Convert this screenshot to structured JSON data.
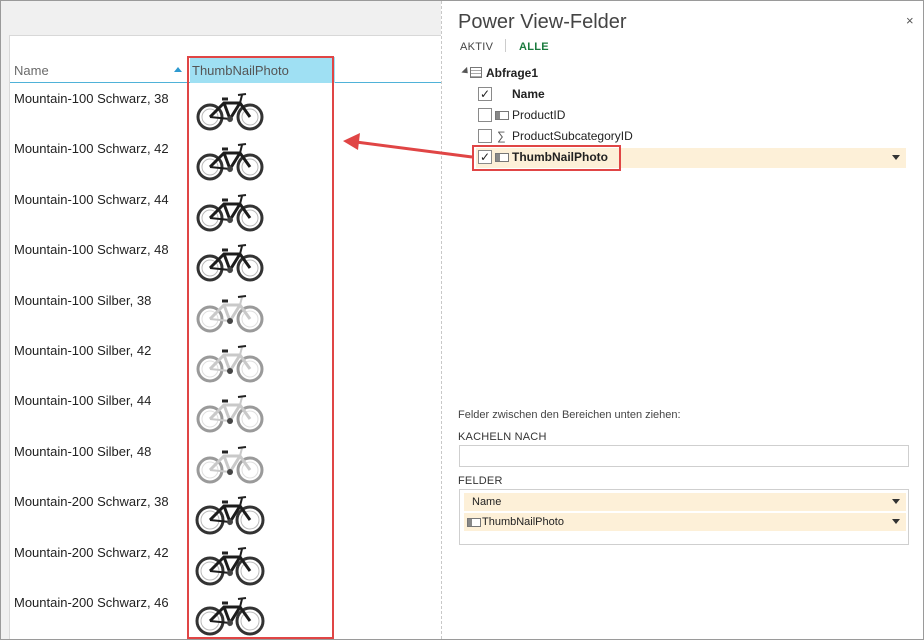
{
  "table": {
    "col_name": "Name",
    "col_thumb": "ThumbNailPhoto",
    "rows": [
      {
        "name": "Mountain-100 Schwarz, 38",
        "bike": "black"
      },
      {
        "name": "Mountain-100 Schwarz, 42",
        "bike": "black"
      },
      {
        "name": "Mountain-100 Schwarz, 44",
        "bike": "black"
      },
      {
        "name": "Mountain-100 Schwarz, 48",
        "bike": "black"
      },
      {
        "name": "Mountain-100 Silber, 38",
        "bike": "silver"
      },
      {
        "name": "Mountain-100 Silber, 42",
        "bike": "silver"
      },
      {
        "name": "Mountain-100 Silber, 44",
        "bike": "silver"
      },
      {
        "name": "Mountain-100 Silber, 48",
        "bike": "silver"
      },
      {
        "name": "Mountain-200 Schwarz, 38",
        "bike": "black200"
      },
      {
        "name": "Mountain-200 Schwarz, 42",
        "bike": "black200"
      },
      {
        "name": "Mountain-200 Schwarz, 46",
        "bike": "black200"
      }
    ]
  },
  "pane": {
    "title": "Power View-Felder",
    "close": "×",
    "tab_active": "AKTIV",
    "tab_all": "ALLE",
    "table_name": "Abfrage1",
    "fields": [
      {
        "label": "Name",
        "checked": true,
        "icon": "none"
      },
      {
        "label": "ProductID",
        "checked": false,
        "icon": "image-field-icon"
      },
      {
        "label": "ProductSubcategoryID",
        "checked": false,
        "icon": "sigma-icon"
      },
      {
        "label": "ThumbNailPhoto",
        "checked": true,
        "icon": "image-field-icon"
      }
    ],
    "hint": "Felder zwischen den Bereichen unten ziehen:",
    "tiles_label": "KACHELN NACH",
    "fields_label": "FELDER",
    "wells": [
      "Name",
      "ThumbNailPhoto"
    ]
  },
  "colors": {
    "highlight_red": "#e04545",
    "header_blue": "#9fe0f3",
    "selected_field": "#fdf0d8",
    "tab_green": "#1b7b3e"
  }
}
